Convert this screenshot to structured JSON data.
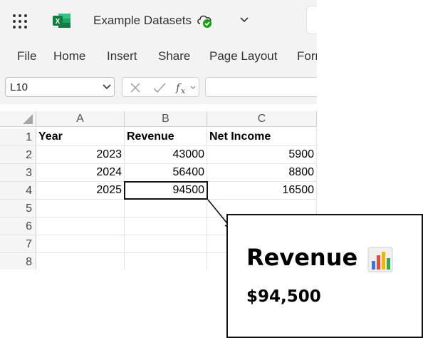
{
  "titlebar": {
    "doc_title": "Example Datasets",
    "app_icon": "excel-icon",
    "sync_icon": "cloud-sync-icon"
  },
  "ribbon": {
    "tabs": [
      "File",
      "Home",
      "Insert",
      "Share",
      "Page Layout",
      "Form"
    ]
  },
  "formula_bar": {
    "name_box": "L10",
    "formula": ""
  },
  "sheet": {
    "columns": [
      "A",
      "B",
      "C"
    ],
    "row_numbers": [
      "1",
      "2",
      "3",
      "4",
      "5",
      "6",
      "7",
      "8"
    ],
    "rows": [
      [
        "Year",
        "Revenue",
        "Net Income"
      ],
      [
        "2023",
        "43000",
        "5900"
      ],
      [
        "2024",
        "56400",
        "8800"
      ],
      [
        "2025",
        "94500",
        "16500"
      ],
      [
        "",
        "",
        ""
      ],
      [
        "",
        "",
        ""
      ],
      [
        "",
        "",
        ""
      ],
      [
        "",
        "",
        ""
      ]
    ],
    "selected_cell": "B4"
  },
  "callout": {
    "title": "Revenue",
    "value": "$94,500",
    "icon": "bar-chart-icon"
  },
  "colors": {
    "excel_green": "#107c41",
    "sync_green": "#13a10e"
  }
}
